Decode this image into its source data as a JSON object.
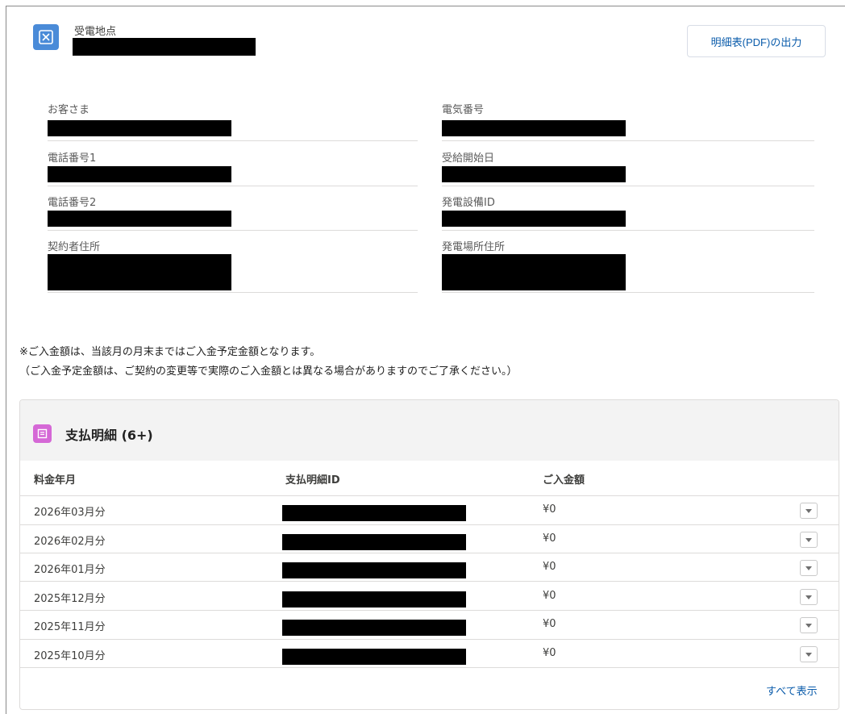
{
  "header": {
    "label": "受電地点",
    "pdf_button": "明細表(PDF)の出力"
  },
  "fields": {
    "customer": "お客さま",
    "phone1": "電話番号1",
    "phone2": "電話番号2",
    "contract_address": "契約者住所",
    "electric_number": "電気番号",
    "supply_start": "受給開始日",
    "generation_id": "発電設備ID",
    "generation_address": "発電場所住所"
  },
  "notes": {
    "line1": "※ご入金額は、当該月の月末まではご入金予定金額となります。",
    "line2": "（ご入金予定金額は、ご契約の変更等で実際のご入金額とは異なる場合がありますのでご了承ください。）"
  },
  "payments": {
    "title": "支払明細 (6+)",
    "columns": [
      "料金年月",
      "支払明細ID",
      "ご入金額"
    ],
    "rows": [
      {
        "month": "2026年03月分",
        "amount": "¥0"
      },
      {
        "month": "2026年02月分",
        "amount": "¥0"
      },
      {
        "month": "2026年01月分",
        "amount": "¥0"
      },
      {
        "month": "2025年12月分",
        "amount": "¥0"
      },
      {
        "month": "2025年11月分",
        "amount": "¥0"
      },
      {
        "month": "2025年10月分",
        "amount": "¥0"
      }
    ],
    "view_all": "すべて表示"
  },
  "colors": {
    "header_icon": "#4a8bd8",
    "card_icon": "#d568d6",
    "link": "#0b5cab"
  }
}
